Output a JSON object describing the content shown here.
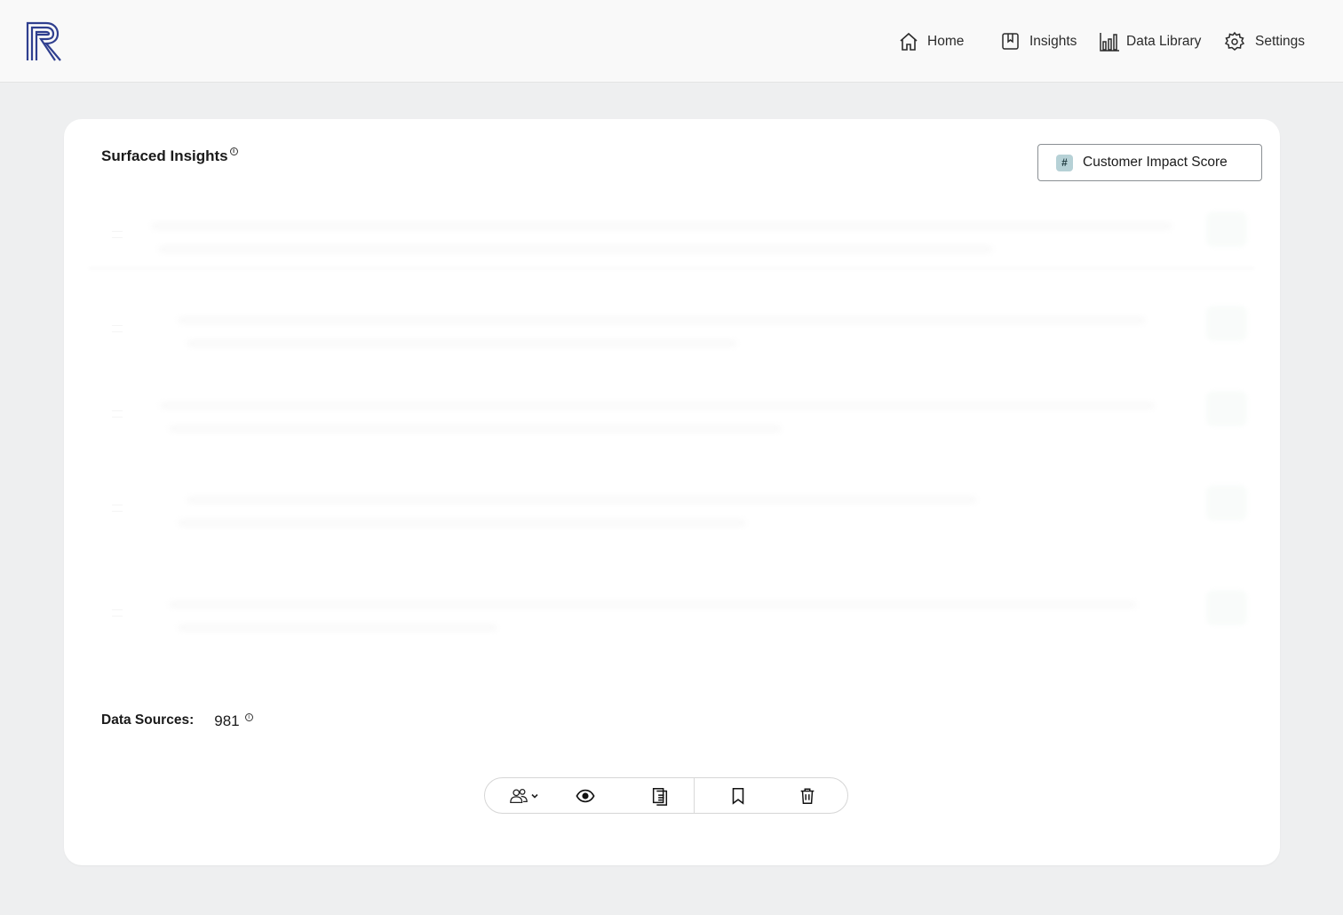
{
  "nav": {
    "home": "Home",
    "insights": "Insights",
    "data_library": "Data Library",
    "settings": "Settings"
  },
  "panel": {
    "title": "Surfaced Insights",
    "info_mark": "i",
    "score_button": {
      "icon": "#",
      "label": "Customer Impact Score"
    },
    "data_sources": {
      "label": "Data Sources:",
      "value": "981",
      "info_mark": "i"
    }
  },
  "icons": {
    "logo": "r-stripes-logo",
    "home": "home-icon",
    "insights": "bookmark-book-icon",
    "data_library": "bar-chart-icon",
    "settings": "gear-icon",
    "toolbar": [
      "users-icon",
      "eye-icon",
      "document-icon",
      "bookmark-icon",
      "trash-icon"
    ]
  },
  "colors": {
    "logo_blue": "#2f3f8f",
    "hash_badge": "#b6d1d6",
    "page_bg": "#eeeff0"
  }
}
